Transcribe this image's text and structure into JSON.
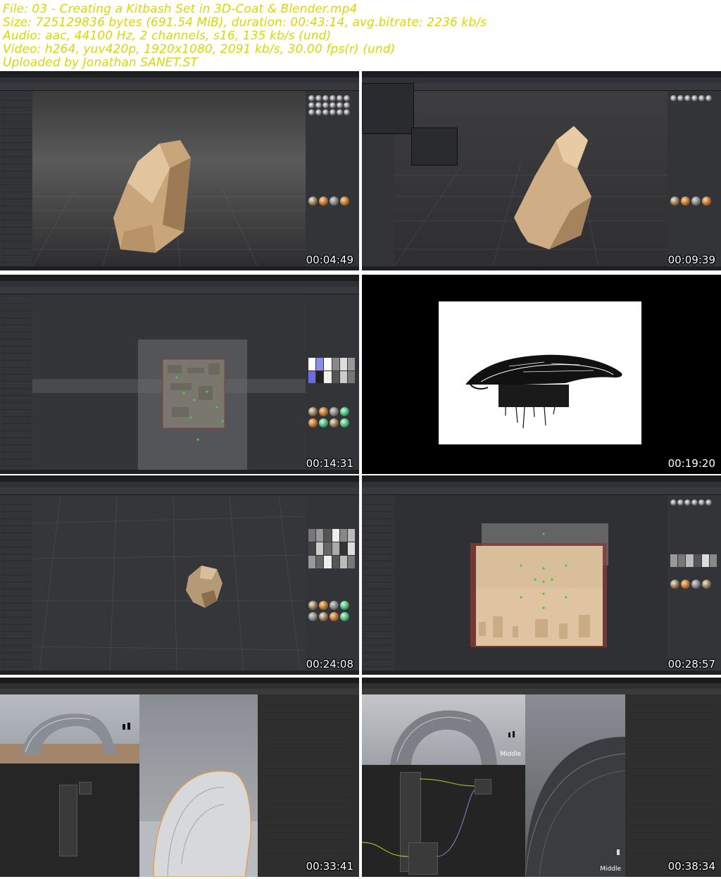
{
  "header": {
    "lines": [
      "File: 03 - Creating a Kitbash Set in 3D-Coat & Blender.mp4",
      "Size: 725129836 bytes (691.54 MiB), duration: 00:43:14, avg.bitrate: 2236 kb/s",
      "Audio: aac, 44100 Hz, 2 channels, s16, 135 kb/s (und)",
      "Video: h264, yuv420p, 1920x1080, 2091 kb/s, 30.00 fps(r) (und)",
      "Uploaded by Jonathan SANET.ST"
    ],
    "text_color": "#d8d800"
  },
  "thumbnails": [
    {
      "timestamp": "00:04:49",
      "app": "3D-Coat",
      "scene": "rock-sculpt"
    },
    {
      "timestamp": "00:09:39",
      "app": "3D-Coat",
      "scene": "rock-sculpt-menu"
    },
    {
      "timestamp": "00:14:31",
      "app": "3D-Coat",
      "scene": "greeble-panel"
    },
    {
      "timestamp": "00:19:20",
      "app": "Sketch",
      "scene": "concept-sketch"
    },
    {
      "timestamp": "00:24:08",
      "app": "3D-Coat",
      "scene": "small-kitbash-piece"
    },
    {
      "timestamp": "00:28:57",
      "app": "3D-Coat",
      "scene": "panel-texture"
    },
    {
      "timestamp": "00:33:41",
      "app": "Blender",
      "scene": "arch-render"
    },
    {
      "timestamp": "00:38:34",
      "app": "Blender",
      "scene": "node-editor-arch"
    }
  ],
  "overlays": {
    "tile8_label_top": "Middle",
    "tile8_label_bottom": "Middle"
  }
}
